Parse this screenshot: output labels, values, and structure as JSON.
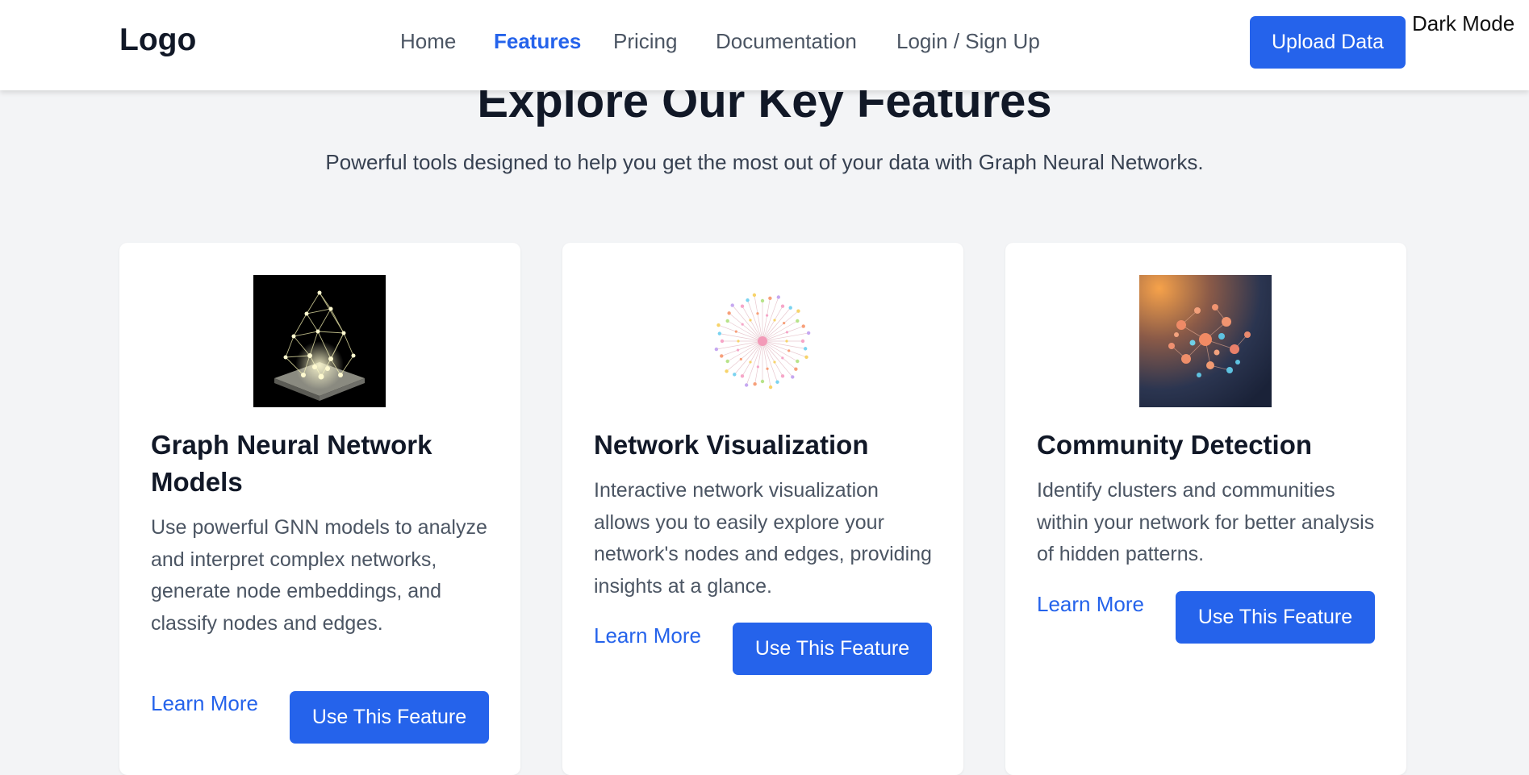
{
  "nav": {
    "logo": "Logo",
    "links": [
      {
        "label": "Home"
      },
      {
        "label": "Features"
      },
      {
        "label": "Pricing"
      },
      {
        "label": "Documentation"
      },
      {
        "label": "Login / Sign Up"
      }
    ],
    "active_link": "Features",
    "upload_label": "Upload Data",
    "dark_mode_label": "Dark Mode"
  },
  "hero": {
    "title": "Explore Our Key Features",
    "subtitle": "Powerful tools designed to help you get the most out of your data with Graph Neural Networks."
  },
  "features": [
    {
      "title": "Graph Neural Network Models",
      "description": "Use powerful GNN models to analyze and interpret complex networks, generate node embeddings, and classify nodes and edges.",
      "learn_more": "Learn More",
      "cta": "Use This Feature",
      "image_icon": "glowing-graph-network-icon"
    },
    {
      "title": "Network Visualization",
      "description": "Interactive network visualization allows you to easily explore your network's nodes and edges, providing insights at a glance.",
      "learn_more": "Learn More",
      "cta": "Use This Feature",
      "image_icon": "radial-network-icon"
    },
    {
      "title": "Community Detection",
      "description": "Identify clusters and communities within your network for better analysis of hidden patterns.",
      "learn_more": "Learn More",
      "cta": "Use This Feature",
      "image_icon": "node-cluster-icon"
    }
  ],
  "colors": {
    "accent": "#2563eb",
    "page_background": "#f3f4f6",
    "card_background": "#ffffff",
    "heading": "#111827",
    "body_text": "#4b5563"
  }
}
